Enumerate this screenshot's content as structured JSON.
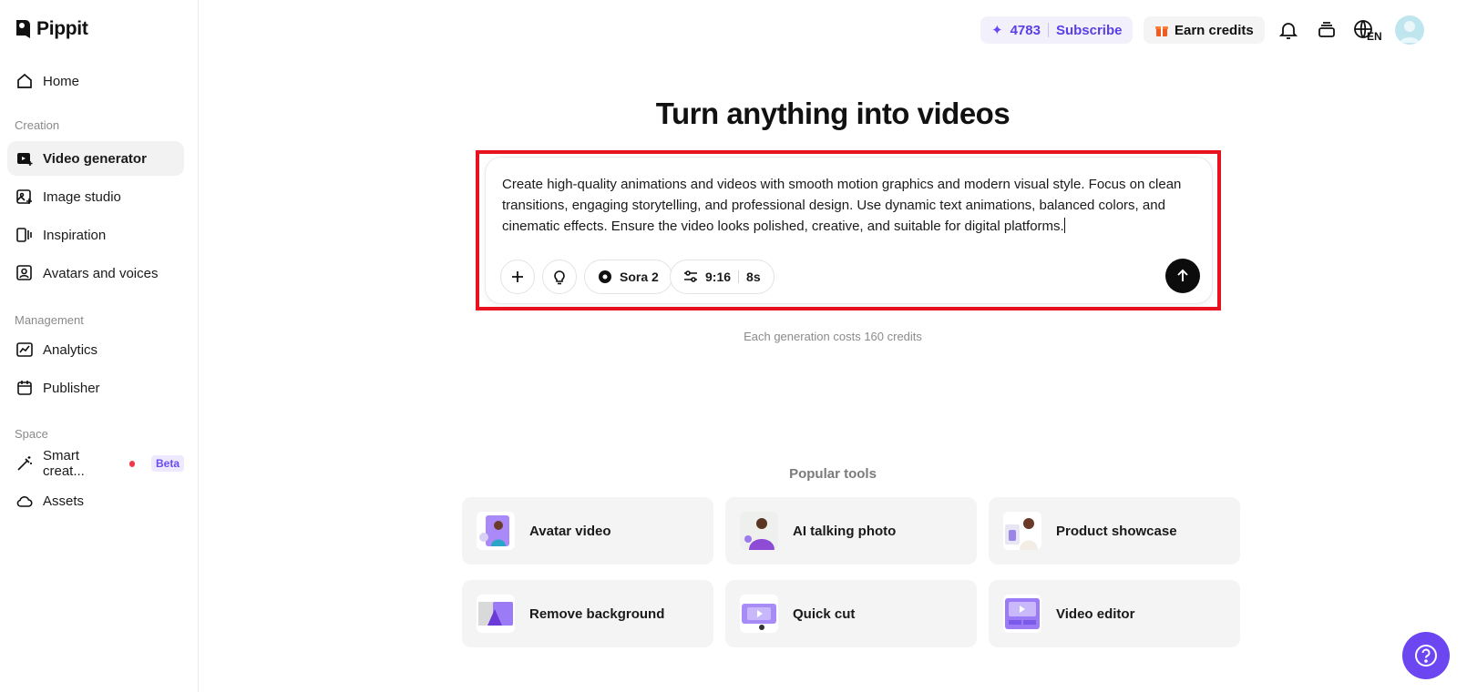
{
  "app": {
    "name": "Pippit"
  },
  "sidebar": {
    "home": "Home",
    "sections": {
      "creation": "Creation",
      "management": "Management",
      "space": "Space"
    },
    "creation_items": [
      {
        "label": "Video generator",
        "icon": "video-plus-icon",
        "active": true
      },
      {
        "label": "Image studio",
        "icon": "image-plus-icon"
      },
      {
        "label": "Inspiration",
        "icon": "inspiration-icon"
      },
      {
        "label": "Avatars and voices",
        "icon": "avatar-icon"
      }
    ],
    "management_items": [
      {
        "label": "Analytics",
        "icon": "analytics-icon"
      },
      {
        "label": "Publisher",
        "icon": "calendar-icon"
      }
    ],
    "space_items": [
      {
        "label": "Smart creat...",
        "icon": "magic-wand-icon",
        "badge": "Beta"
      },
      {
        "label": "Assets",
        "icon": "cloud-icon"
      }
    ]
  },
  "topbar": {
    "credits": "4783",
    "subscribe": "Subscribe",
    "earn_credits": "Earn credits",
    "language": "EN"
  },
  "main": {
    "title": "Turn anything into videos",
    "prompt": "Create high-quality animations and videos with smooth motion graphics and modern visual style. Focus on clean transitions, engaging storytelling, and professional design. Use dynamic text animations, balanced colors, and cinematic effects. Ensure the video looks polished, creative, and suitable for digital platforms.",
    "model": "Sora 2",
    "aspect_ratio": "9:16",
    "duration": "8s",
    "cost_note": "Each generation costs 160 credits",
    "popular_label": "Popular tools",
    "tools": [
      {
        "label": "Avatar video"
      },
      {
        "label": "AI talking photo"
      },
      {
        "label": "Product showcase"
      },
      {
        "label": "Remove background"
      },
      {
        "label": "Quick cut"
      },
      {
        "label": "Video editor"
      }
    ]
  },
  "colors": {
    "accent": "#6b46f1",
    "highlight": "#e8121f",
    "credits_text": "#5b3ee6"
  }
}
